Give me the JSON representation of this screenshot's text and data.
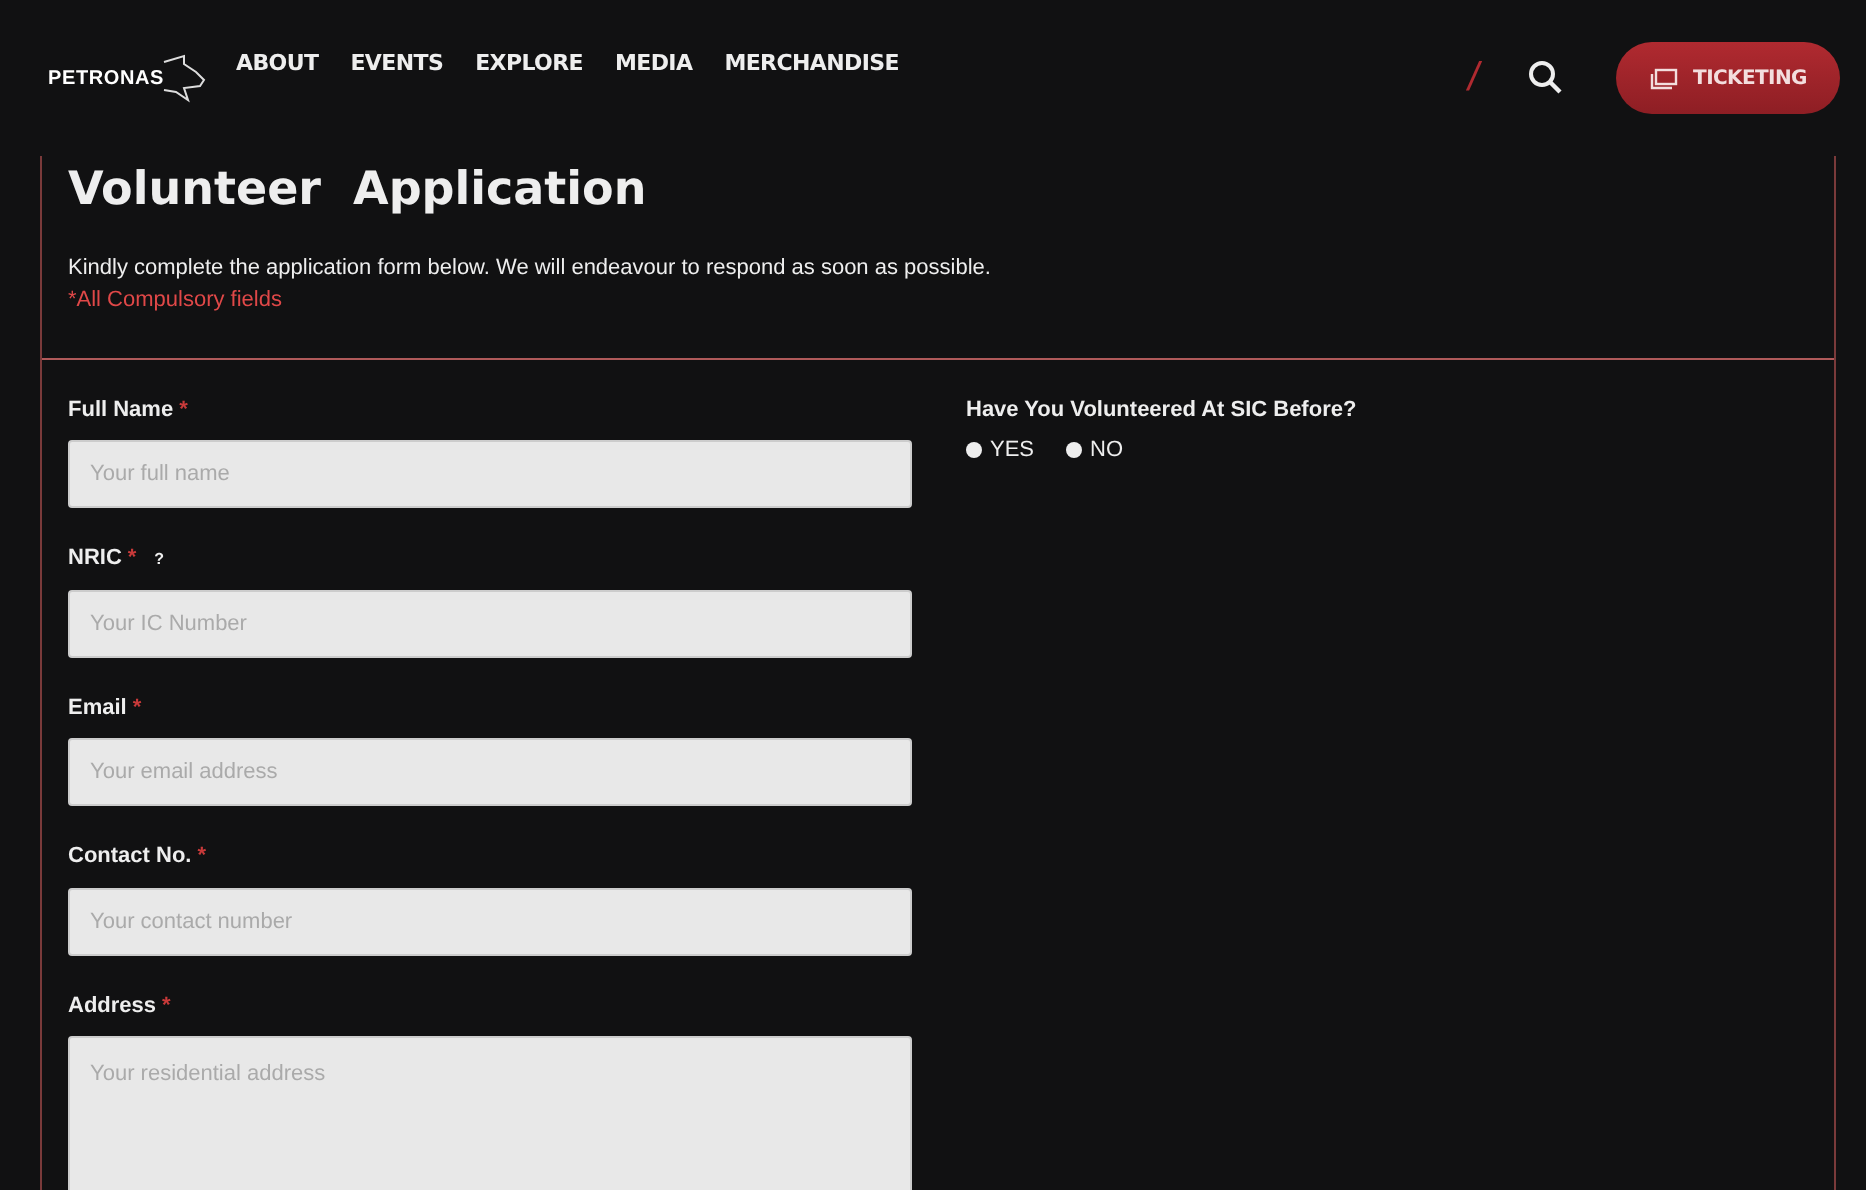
{
  "navbar": {
    "logo": "PETRONAS",
    "items": [
      {
        "label": "ABOUT"
      },
      {
        "label": "EVENTS"
      },
      {
        "label": "EXPLORE"
      },
      {
        "label": "MEDIA"
      },
      {
        "label": "MERCHANDISE"
      }
    ],
    "divider": "/",
    "ticket_button": "TICKETING"
  },
  "header": {
    "title": "Volunteer  Application",
    "intro": "Kindly complete the application form below. We will endeavour to respond as soon as possible.",
    "required_note": "*All Compulsory fields"
  },
  "fields": [
    {
      "kind": "input",
      "label": "Full Name",
      "required": "*",
      "placeholder": "Your full name"
    },
    {
      "kind": "input",
      "label": "NRIC",
      "required": "*",
      "help": "?",
      "placeholder": "Your IC Number"
    },
    {
      "kind": "input",
      "label": "Email",
      "required": "*",
      "placeholder": "Your email address"
    },
    {
      "kind": "input",
      "label": "Contact No.",
      "required": "*",
      "placeholder": "Your contact number"
    },
    {
      "kind": "textarea",
      "label": "Address",
      "required": "*",
      "placeholder": "Your residential address"
    }
  ],
  "volunteered_before": {
    "question": "Have You Volunteered At SIC Before?",
    "options": [
      {
        "label": "YES",
        "selected": false
      },
      {
        "label": "NO",
        "selected": false
      }
    ]
  }
}
